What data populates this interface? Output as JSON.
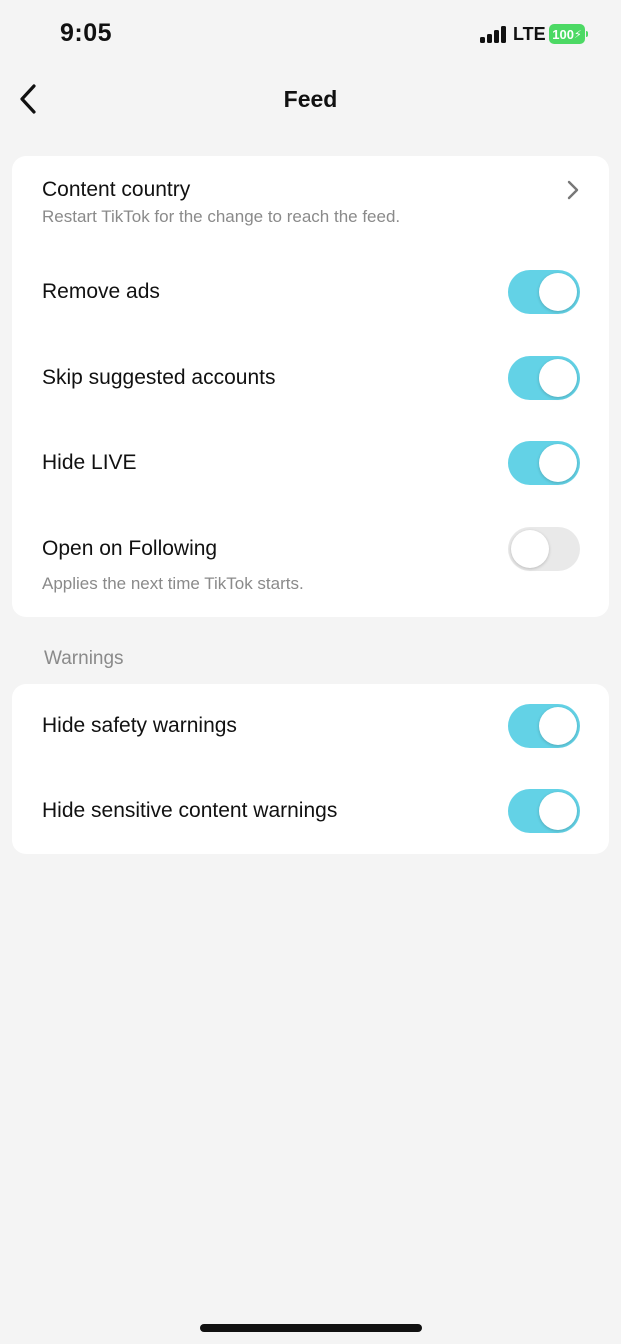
{
  "status_bar": {
    "time": "9:05",
    "network": "LTE",
    "battery": "100"
  },
  "nav": {
    "title": "Feed"
  },
  "feed_section": {
    "content_country": {
      "label": "Content country",
      "sublabel": "Restart TikTok for the change to reach the feed."
    },
    "remove_ads": {
      "label": "Remove ads",
      "enabled": true
    },
    "skip_suggested": {
      "label": "Skip suggested accounts",
      "enabled": true
    },
    "hide_live": {
      "label": "Hide LIVE",
      "enabled": true
    },
    "open_following": {
      "label": "Open on Following",
      "sublabel": "Applies the next time TikTok starts.",
      "enabled": false
    }
  },
  "warnings_section": {
    "header": "Warnings",
    "hide_safety": {
      "label": "Hide safety warnings",
      "enabled": true
    },
    "hide_sensitive": {
      "label": "Hide sensitive content warnings",
      "enabled": true
    }
  },
  "colors": {
    "toggle_on": "#63d2e6",
    "toggle_off": "#e9e9e9",
    "battery": "#4cd964"
  }
}
